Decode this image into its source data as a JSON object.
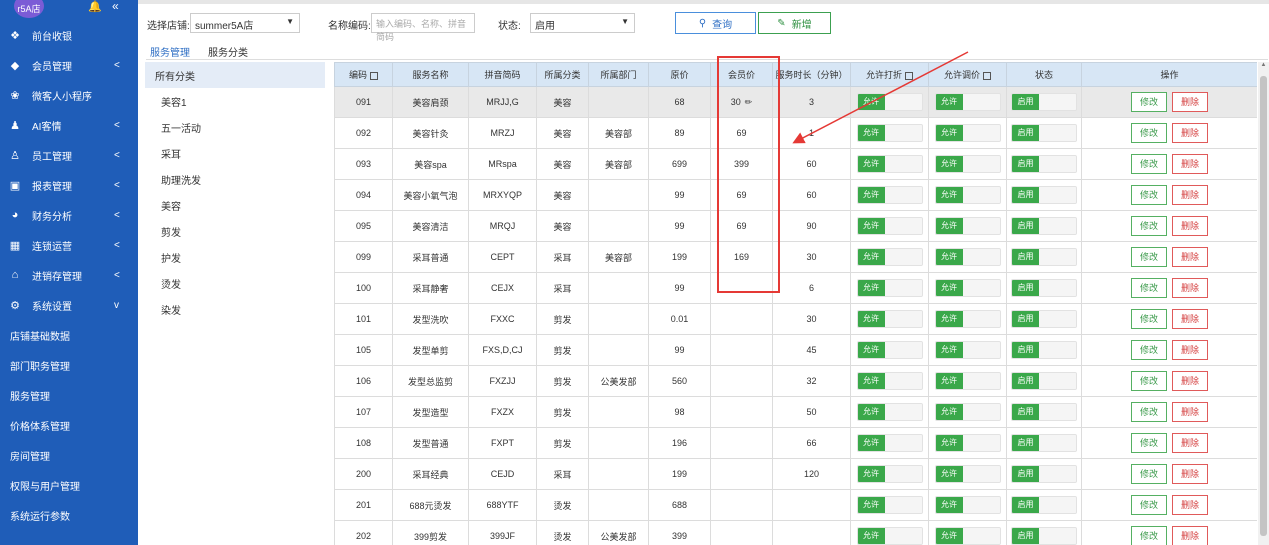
{
  "sidebar": {
    "store_badge": "r5A店",
    "menu": [
      {
        "label": "前台收银",
        "icon": "user-circle-icon",
        "arrow": ""
      },
      {
        "label": "会员管理",
        "icon": "diamond-icon",
        "arrow": "<"
      },
      {
        "label": "微客人小程序",
        "icon": "mini-program-icon",
        "arrow": ""
      },
      {
        "label": "AI客情",
        "icon": "person-icon",
        "arrow": "<"
      },
      {
        "label": "员工管理",
        "icon": "staff-icon",
        "arrow": "<"
      },
      {
        "label": "报表管理",
        "icon": "monitor-icon",
        "arrow": "<"
      },
      {
        "label": "财务分析",
        "icon": "pie-icon",
        "arrow": "<"
      },
      {
        "label": "连锁运营",
        "icon": "building-icon",
        "arrow": "<"
      },
      {
        "label": "进销存管理",
        "icon": "home-icon",
        "arrow": "<"
      },
      {
        "label": "系统设置",
        "icon": "gear-icon",
        "arrow": "v"
      }
    ],
    "submenu": [
      "店铺基础数据",
      "部门职务管理",
      "服务管理",
      "价格体系管理",
      "房间管理",
      "权限与用户管理",
      "系统运行参数"
    ]
  },
  "filters": {
    "store_label": "选择店铺:",
    "store_value": "summer5A店",
    "name_label": "名称编码:",
    "name_placeholder": "输入编码、名称、拼音简码",
    "status_label": "状态:",
    "status_value": "启用",
    "query_label": "查询",
    "add_label": "新增"
  },
  "tabs": [
    "服务管理",
    "服务分类"
  ],
  "categories": [
    "所有分类",
    "美容1",
    "五一活动",
    "采耳",
    "助理洗发",
    "美容",
    "剪发",
    "护发",
    "烫发",
    "染发"
  ],
  "table": {
    "headers": [
      "编码",
      "服务名称",
      "拼音简码",
      "所属分类",
      "所属部门",
      "原价",
      "会员价",
      "服务时长（分钟）",
      "允许打折",
      "允许调价",
      "状态",
      "操作"
    ],
    "toggle_allow": "允许",
    "toggle_enabled": "启用",
    "edit_label": "修改",
    "delete_label": "删除",
    "rows": [
      [
        "091",
        "美容肩颈",
        "MRJJ,G",
        "美容",
        "",
        "68",
        "30",
        "3"
      ],
      [
        "092",
        "美容针灸",
        "MRZJ",
        "美容",
        "美容部",
        "89",
        "69",
        "1"
      ],
      [
        "093",
        "美容spa",
        "MRspa",
        "美容",
        "美容部",
        "699",
        "399",
        "60"
      ],
      [
        "094",
        "美容小氧气泡",
        "MRXYQP",
        "美容",
        "",
        "99",
        "69",
        "60"
      ],
      [
        "095",
        "美容清洁",
        "MRQJ",
        "美容",
        "",
        "99",
        "69",
        "90"
      ],
      [
        "099",
        "采耳普通",
        "CEPT",
        "采耳",
        "美容部",
        "199",
        "169",
        "30"
      ],
      [
        "100",
        "采耳静奢",
        "CEJX",
        "采耳",
        "",
        "99",
        "",
        "6"
      ],
      [
        "101",
        "发型洗吹",
        "FXXC",
        "剪发",
        "",
        "0.01",
        "",
        "30"
      ],
      [
        "105",
        "发型单剪",
        "FXS,D,CJ",
        "剪发",
        "",
        "99",
        "",
        "45"
      ],
      [
        "106",
        "发型总监剪",
        "FXZJJ",
        "剪发",
        "公美发部",
        "560",
        "",
        "32"
      ],
      [
        "107",
        "发型造型",
        "FXZX",
        "剪发",
        "",
        "98",
        "",
        "50"
      ],
      [
        "108",
        "发型普通",
        "FXPT",
        "剪发",
        "",
        "196",
        "",
        "66"
      ],
      [
        "200",
        "采耳经典",
        "CEJD",
        "采耳",
        "",
        "199",
        "",
        "120"
      ],
      [
        "201",
        "688元烫发",
        "688YTF",
        "烫发",
        "",
        "688",
        "",
        ""
      ],
      [
        "202",
        "399剪发",
        "399JF",
        "烫发",
        "公美发部",
        "399",
        "",
        ""
      ]
    ]
  },
  "colors": {
    "sidebar_bg": "#1f5db8",
    "header_bg": "#d7e6f5",
    "toggle_on": "#3aa84a",
    "annotation": "#e53935"
  }
}
